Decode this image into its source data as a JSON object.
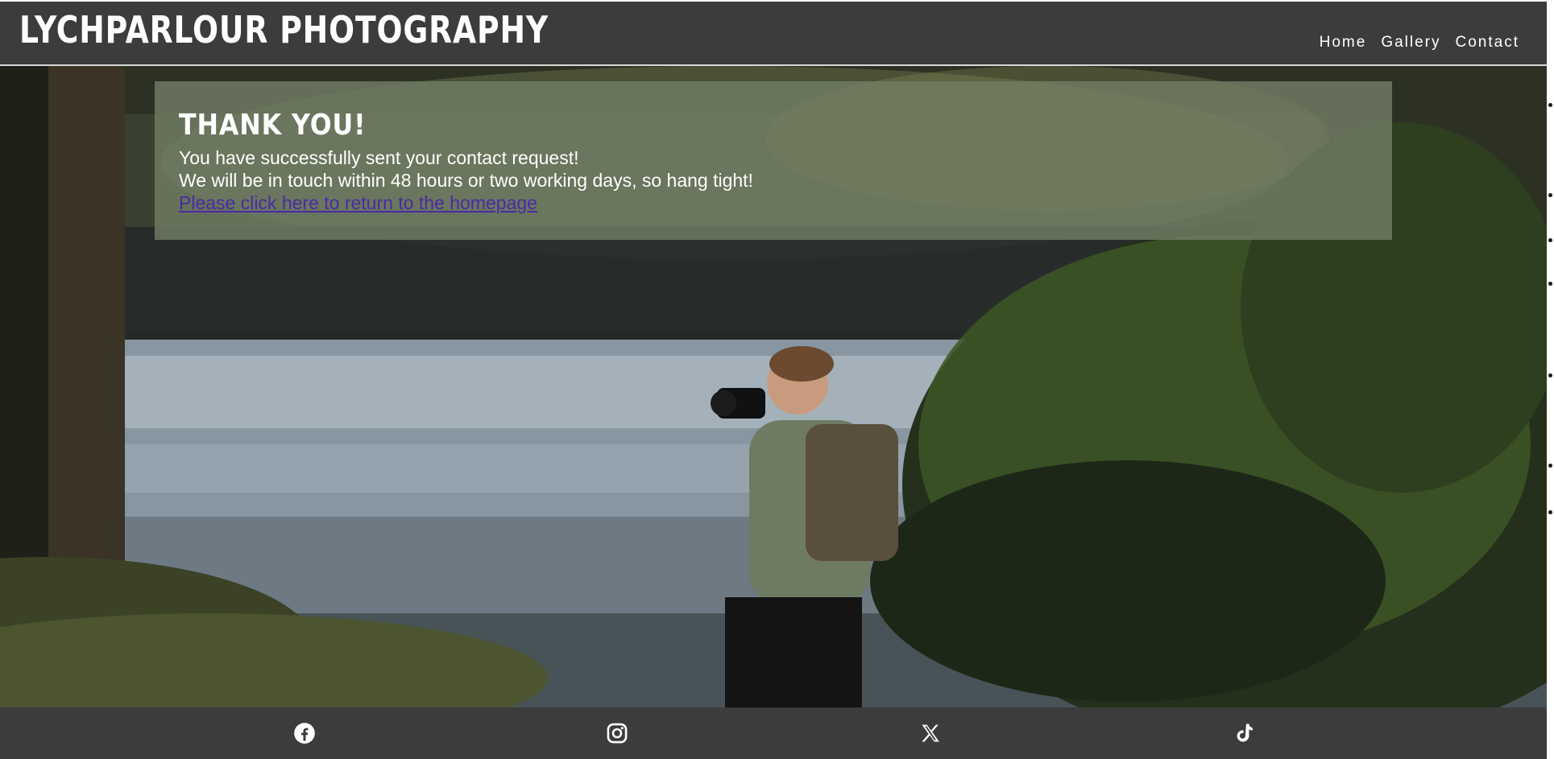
{
  "header": {
    "brand": "LYCHPARLOUR PHOTOGRAPHY",
    "nav": [
      {
        "label": "Home"
      },
      {
        "label": "Gallery"
      },
      {
        "label": "Contact"
      }
    ]
  },
  "message": {
    "heading": "THANK YOU!",
    "line1": "You have successfully sent your contact request!",
    "line2": "We will be in touch within 48 hours or two working days, so hang tight!",
    "link": "Please click here to return to the homepage"
  },
  "footer": {
    "social": [
      {
        "icon": "facebook-icon"
      },
      {
        "icon": "instagram-icon"
      },
      {
        "icon": "x-icon"
      },
      {
        "icon": "tiktok-icon"
      }
    ]
  },
  "colors": {
    "header_bg": "#3c3c3c",
    "panel_bg": "#707c64",
    "link": "#4b2aa6"
  }
}
